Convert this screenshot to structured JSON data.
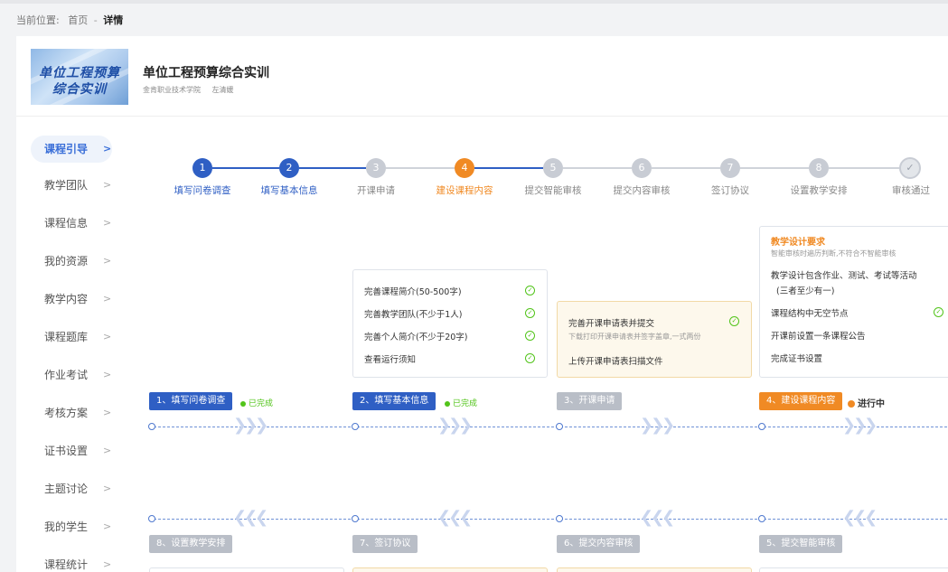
{
  "breadcrumb": {
    "prefix": "当前位置:",
    "home": "首页",
    "separator": "-",
    "current": "详情"
  },
  "course": {
    "cover_line1": "单位工程预算",
    "cover_line2": "综合实训",
    "title": "单位工程预算综合实训",
    "school": "金肯职业技术学院",
    "teacher": "左清媛"
  },
  "sidebar": {
    "items": [
      {
        "label": "课程引导",
        "active": true
      },
      {
        "label": "教学团队"
      },
      {
        "label": "课程信息"
      },
      {
        "label": "我的资源"
      },
      {
        "label": "教学内容"
      },
      {
        "label": "课程题库"
      },
      {
        "label": "作业考试"
      },
      {
        "label": "考核方案"
      },
      {
        "label": "证书设置"
      },
      {
        "label": "主题讨论"
      },
      {
        "label": "我的学生"
      },
      {
        "label": "课程统计"
      }
    ],
    "chevron": ">"
  },
  "steps": [
    {
      "num": "1",
      "label": "填写问卷调查",
      "state": "done"
    },
    {
      "num": "2",
      "label": "填写基本信息",
      "state": "done"
    },
    {
      "num": "3",
      "label": "开课申请",
      "state": "todo"
    },
    {
      "num": "4",
      "label": "建设课程内容",
      "state": "current"
    },
    {
      "num": "5",
      "label": "提交智能审核",
      "state": "todo"
    },
    {
      "num": "6",
      "label": "提交内容审核",
      "state": "todo"
    },
    {
      "num": "7",
      "label": "签订协议",
      "state": "todo"
    },
    {
      "num": "8",
      "label": "设置教学安排",
      "state": "todo"
    },
    {
      "num": "✓",
      "label": "审核通过",
      "state": "todo"
    }
  ],
  "tips": {
    "basic": {
      "lines": [
        "完善课程简介(50-500字)",
        "完善教学团队(不少于1人)",
        "完善个人简介(不少于20字)",
        "查看运行须知"
      ]
    },
    "apply": {
      "line1": "完善开课申请表并提交",
      "sub": "下载打印开课申请表并签字盖章,一式两份",
      "line2": "上传开课申请表扫描文件"
    },
    "design": {
      "head": "教学设计要求",
      "sub": "智能审核时遍历判断,不符合不智能审核",
      "lines": [
        "教学设计包含作业、测试、考试等活动",
        "(三者至少有一)",
        "课程结构中无空节点",
        "开课前设置一条课程公告",
        "完成证书设置"
      ]
    }
  },
  "flow": {
    "top": [
      {
        "label": "1、填写问卷调查",
        "status": "已完成"
      },
      {
        "label": "2、填写基本信息",
        "status": "已完成"
      },
      {
        "label": "3、开课申请",
        "status": ""
      },
      {
        "label": "4、建设课程内容",
        "status": "进行中"
      }
    ],
    "bottom": [
      {
        "label": "8、设置教学安排"
      },
      {
        "label": "7、签订协议"
      },
      {
        "label": "6、提交内容审核"
      },
      {
        "label": "5、提交智能审核"
      }
    ],
    "chevrons_right": "❯❯❯",
    "chevrons_left": "❮❮❮"
  },
  "colors": {
    "primary": "#2f5fc4",
    "current": "#f08a24",
    "done": "#52c41a",
    "inactive": "#c8ccd4"
  }
}
